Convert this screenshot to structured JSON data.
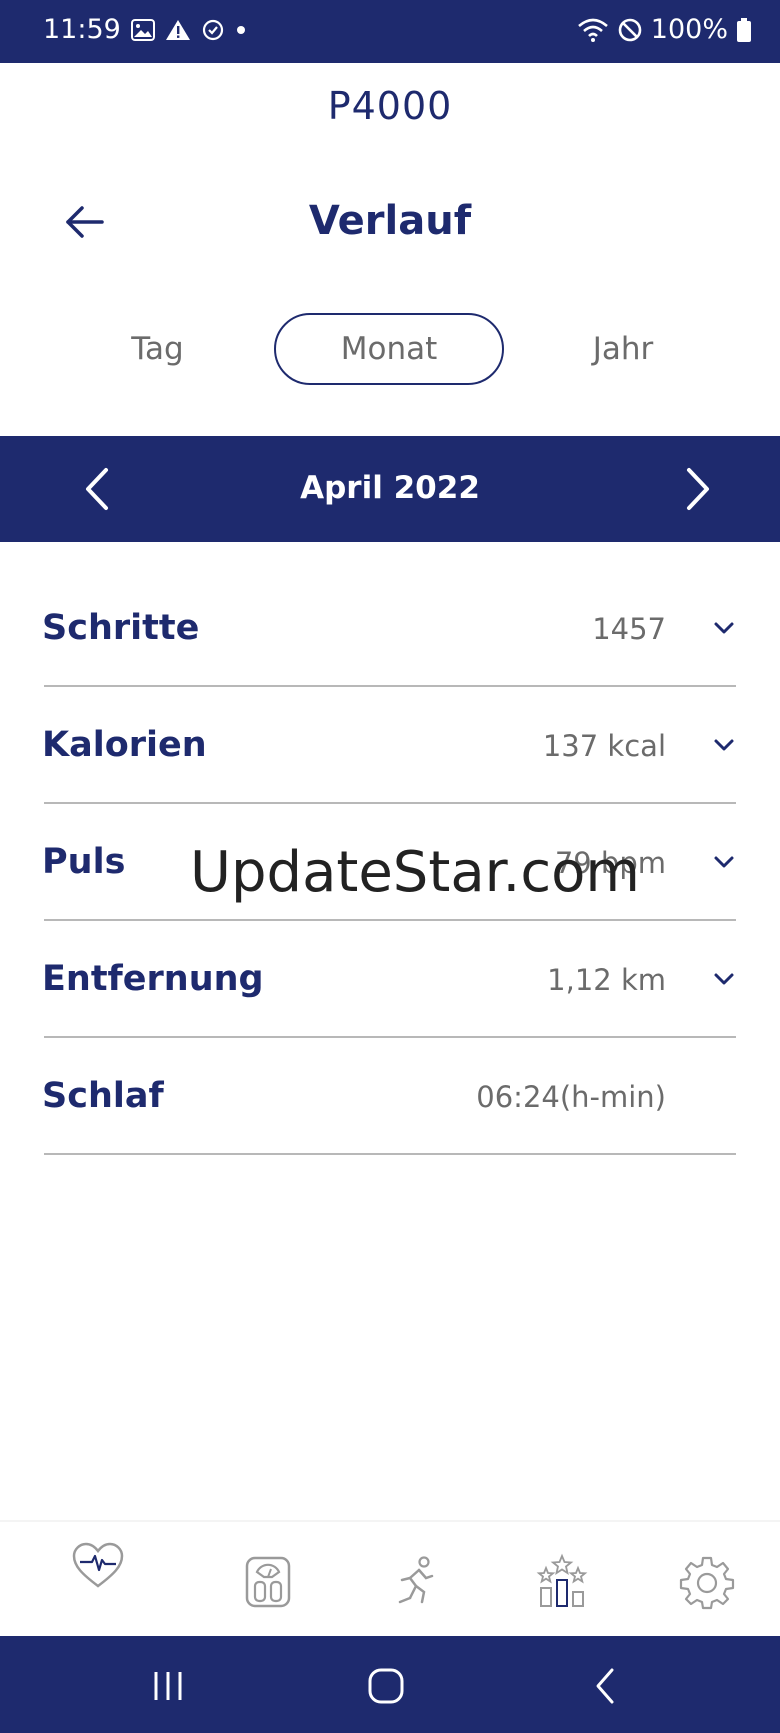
{
  "status_bar": {
    "time": "11:59",
    "battery": "100%",
    "left_icons": [
      "image-icon",
      "warning-icon",
      "sync-icon",
      "dot-icon"
    ],
    "right_icons": [
      "wifi-icon",
      "dnd-icon",
      "battery-icon"
    ]
  },
  "device": {
    "name": "P4000"
  },
  "header": {
    "title": "Verlauf"
  },
  "tabs": {
    "day": "Tag",
    "month": "Monat",
    "year": "Jahr",
    "selected": "Monat"
  },
  "period": {
    "label": "April 2022"
  },
  "metrics": [
    {
      "label": "Schritte",
      "value": "1457",
      "expandable": true
    },
    {
      "label": "Kalorien",
      "value": "137 kcal",
      "expandable": true
    },
    {
      "label": "Puls",
      "value": "79 bpm",
      "expandable": true
    },
    {
      "label": "Entfernung",
      "value": "1,12 km",
      "expandable": true
    },
    {
      "label": "Schlaf",
      "value": "06:24(h-min)",
      "expandable": false
    }
  ],
  "watermark": "UpdateStar.com",
  "bottom_nav": [
    "heart-icon",
    "scale-icon",
    "running-icon",
    "trophy-stars-icon",
    "settings-gear-icon"
  ],
  "colors": {
    "primary": "#1e2a6e",
    "text_secondary": "#6b6b6b",
    "divider": "#b8b8b8",
    "nav_icon": "#9a9a9a"
  }
}
